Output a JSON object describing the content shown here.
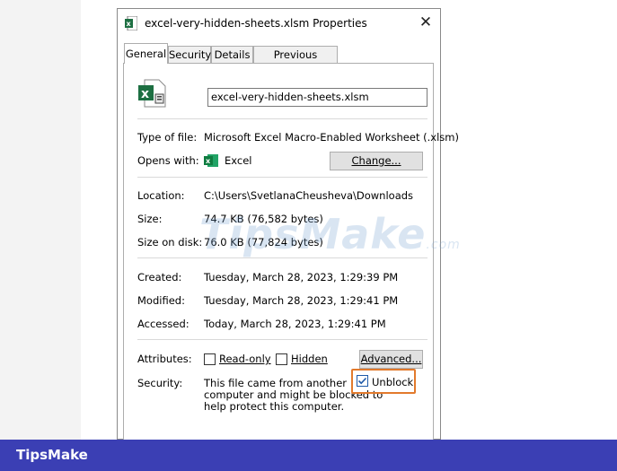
{
  "dialog": {
    "title": "excel-very-hidden-sheets.xlsm Properties",
    "close_symbol": "✕"
  },
  "tabs": [
    {
      "label": "General",
      "active": true
    },
    {
      "label": "Security",
      "active": false
    },
    {
      "label": "Details",
      "active": false
    },
    {
      "label": "Previous Versions",
      "active": false
    }
  ],
  "general": {
    "file_name": "excel-very-hidden-sheets.xlsm",
    "type_label": "Type of file:",
    "type_value": "Microsoft Excel Macro-Enabled Worksheet (.xlsm)",
    "opens_label": "Opens with:",
    "opens_value": "Excel",
    "change_button": "Change...",
    "location_label": "Location:",
    "location_value": "C:\\Users\\SvetlanaCheusheva\\Downloads",
    "size_label": "Size:",
    "size_value": "74.7 KB (76,582 bytes)",
    "size_on_disk_label": "Size on disk:",
    "size_on_disk_value": "76.0 KB (77,824 bytes)",
    "created_label": "Created:",
    "created_value": "Tuesday, March 28, 2023, 1:29:39 PM",
    "modified_label": "Modified:",
    "modified_value": "Tuesday, March 28, 2023, 1:29:41 PM",
    "accessed_label": "Accessed:",
    "accessed_value": "Today, March 28, 2023, 1:29:41 PM",
    "attributes_label": "Attributes:",
    "readonly_label": "Read-only",
    "hidden_label": "Hidden",
    "advanced_button": "Advanced...",
    "security_label": "Security:",
    "security_line1": "This file came from another",
    "security_line2": "computer and might be blocked to",
    "security_line3": "help protect this computer.",
    "unblock_label": "Unblock",
    "unblock_checked": true
  },
  "watermark": {
    "main": "TipsMake",
    "suffix": ".com"
  },
  "footer": {
    "brand": "TipsMake"
  },
  "colors": {
    "accent_frame": "#e27a2c",
    "excel_green": "#1d6f42",
    "banner": "#3b3fb4"
  },
  "icons": [
    "excel-file-icon",
    "excel-app-icon",
    "close-icon",
    "checkbox-checked-icon"
  ]
}
